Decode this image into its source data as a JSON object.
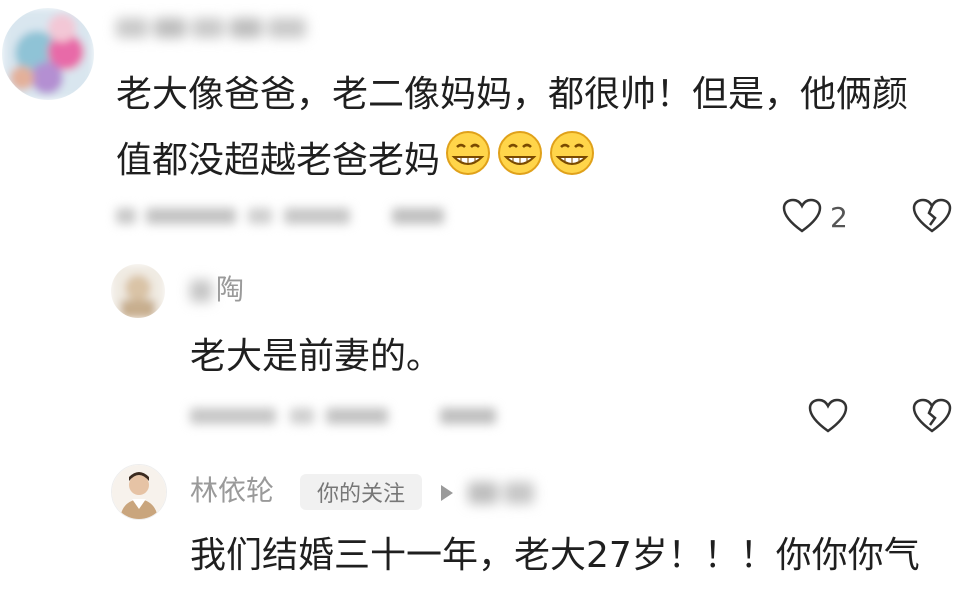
{
  "comments": [
    {
      "username": "",
      "lines": [
        "老大像爸爸，老二像妈妈，都很帅！但是，他俩颜",
        "值都没超越老爸老妈"
      ],
      "emojis": [
        "grinning-face",
        "grinning-face",
        "grinning-face"
      ],
      "meta": "",
      "like_count": "2"
    },
    {
      "username_visible": "陶",
      "content": "老大是前妻的。",
      "meta": ""
    },
    {
      "username": "林依轮",
      "badge": "你的关注",
      "content": "我们结婚三十一年，老大27岁！！！你你你气"
    }
  ],
  "colors": {
    "text": "#1f1f1f",
    "muted": "#9a9a9a",
    "badge_bg": "#f1f1f1",
    "emoji_fill": "#ffd54a",
    "emoji_stroke": "#e0a11a"
  }
}
